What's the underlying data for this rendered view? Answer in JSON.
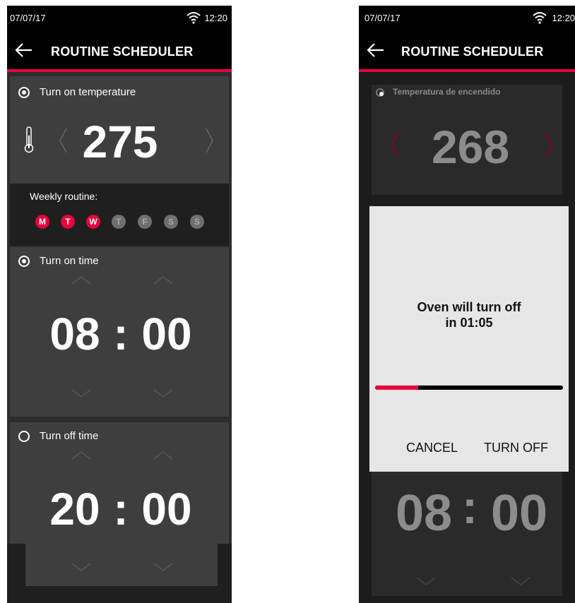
{
  "left": {
    "status": {
      "date": "07/07/17",
      "time": "12:20"
    },
    "header": {
      "title": "ROUTINE SCHEDULER"
    },
    "temperature": {
      "label": "Turn on temperature",
      "value": "275"
    },
    "weekly": {
      "label": "Weekly routine:",
      "days": [
        {
          "letter": "M",
          "active": true
        },
        {
          "letter": "T",
          "active": true
        },
        {
          "letter": "W",
          "active": true
        },
        {
          "letter": "T",
          "active": false
        },
        {
          "letter": "F",
          "active": false
        },
        {
          "letter": "S",
          "active": false
        },
        {
          "letter": "S",
          "active": false
        }
      ]
    },
    "turn_on": {
      "label": "Turn on time",
      "hours": "08",
      "minutes": "00",
      "separator": ":"
    },
    "turn_off": {
      "label": "Turn off time",
      "hours": "20",
      "minutes": "00",
      "separator": ":"
    }
  },
  "right": {
    "status": {
      "date": "07/07/17",
      "time": "12:20"
    },
    "header": {
      "title": "ROUTINE SCHEDULER"
    },
    "temperature": {
      "label": "Temperatura de encendido",
      "value": "268"
    },
    "dialog": {
      "message_line1": "Oven will turn off",
      "message_line2": "in 01:05",
      "progress": 0.23,
      "cancel_label": "CANCEL",
      "turn_off_label": "TURN OFF"
    },
    "time": {
      "hours": "08",
      "minutes": "00",
      "separator": ":"
    }
  },
  "colors": {
    "accent": "#e6003c",
    "card": "#3e3e3e",
    "background": "#2d2d2d",
    "bar": "#000000"
  }
}
